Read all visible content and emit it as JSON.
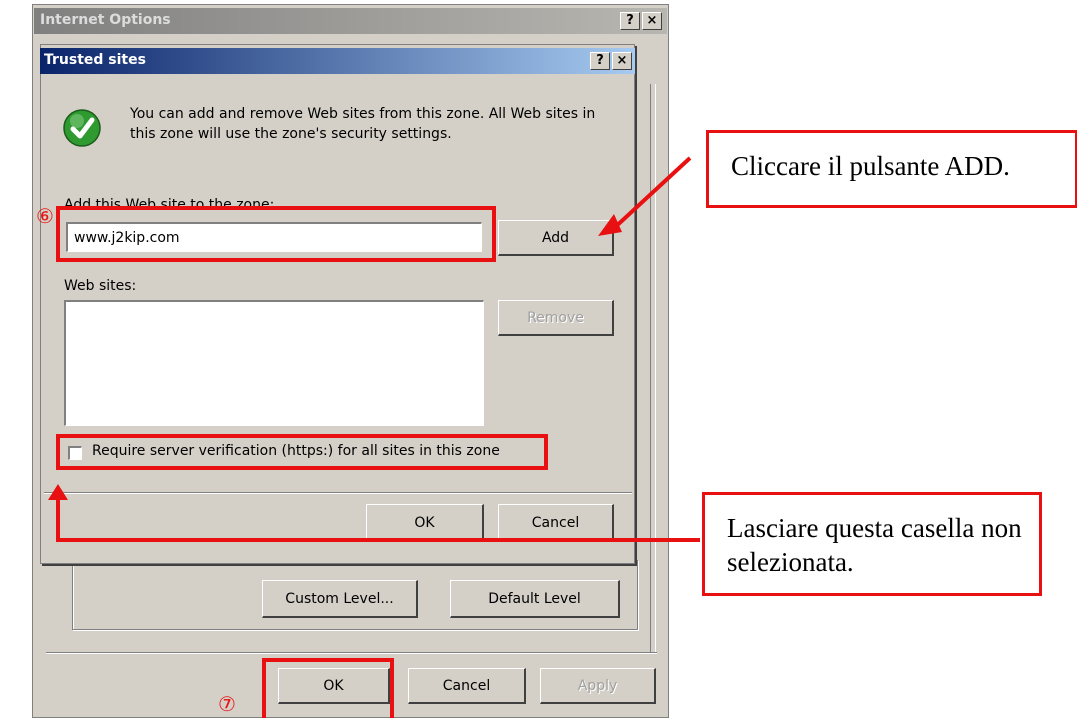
{
  "outer_dialog": {
    "title": "Internet Options",
    "help_btn": "?",
    "close_btn": "×",
    "buttons": {
      "custom_level": "Custom Level...",
      "default_level": "Default Level"
    },
    "footer": {
      "ok": "OK",
      "cancel": "Cancel",
      "apply": "Apply"
    }
  },
  "trusted_dialog": {
    "title": "Trusted sites",
    "help_btn": "?",
    "close_btn": "×",
    "description": "You can add and remove Web sites from this zone. All Web sites in this zone will use the zone's security settings.",
    "add_label": "Add this Web site to the zone:",
    "site_input_value": "www.j2kip.com",
    "add_button": "Add",
    "web_sites_label": "Web sites:",
    "remove_button": "Remove",
    "require_https_label": "Require server verification (https:) for all sites in this zone",
    "require_https_checked": false,
    "ok": "OK",
    "cancel": "Cancel"
  },
  "annotations": {
    "step6": "⑥",
    "step7": "⑦",
    "callout_add": "Cliccare il pulsante ADD.",
    "callout_checkbox": "Lasciare questa casella non selezionata."
  },
  "colors": {
    "annotation_red": "#e81010",
    "title_active": "#0a246a",
    "dialog_face": "#d4d0c8",
    "check_green": "#2f9a2f"
  },
  "icons": {
    "info": "green-checkmark-icon",
    "help": "question-icon",
    "close": "close-icon"
  }
}
